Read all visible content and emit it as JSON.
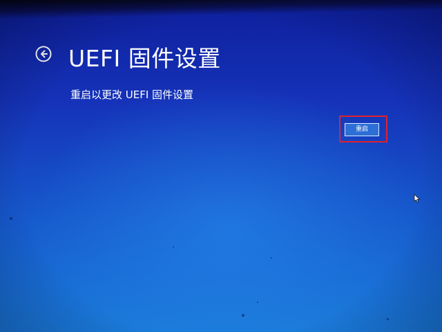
{
  "window": {
    "title": "UEFI 固件设置"
  },
  "header": {
    "back_icon": "arrow-left-circle-icon"
  },
  "main": {
    "description": "重启以更改 UEFI 固件设置",
    "restart_button_label": "重启"
  },
  "colors": {
    "background_top": "#0e1f9c",
    "background_bottom": "#1a7ad8",
    "text": "#ffffff",
    "button_fill": "#2d6fd6",
    "highlight_box": "#e0222a"
  },
  "icons": {
    "back": "arrow-left-circle-icon",
    "cursor": "mouse-pointer-icon"
  }
}
